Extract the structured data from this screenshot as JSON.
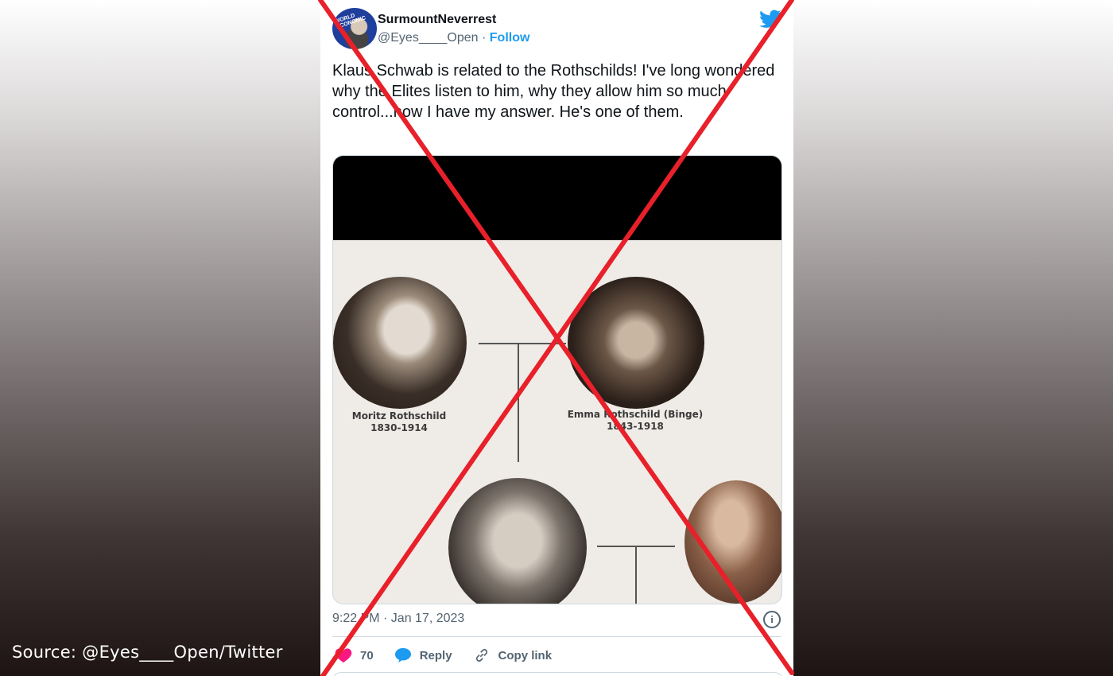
{
  "source_caption": "Source: @Eyes____Open/Twitter",
  "tweet": {
    "display_name": "SurmountNeverrest",
    "handle": "@Eyes____Open",
    "separator": " · ",
    "follow_label": "Follow",
    "avatar_text": "WORLD ECONOMIC",
    "text": "Klaus Schwab is related to the Rothschilds! I've long wondered why the Elites listen to him, why they allow him so much control...now I have my answer. He's one of them.",
    "timestamp": "9:22 PM · Jan 17, 2023",
    "media": {
      "captions": [
        {
          "name": "Moritz Rothschild",
          "years": "1830-1914"
        },
        {
          "name": "Emma Rothschild (Binge)",
          "years": "1843-1918"
        }
      ]
    },
    "actions": {
      "like_count": "70",
      "reply_label": "Reply",
      "copy_label": "Copy link"
    }
  },
  "colors": {
    "accent": "#1d9bf0",
    "like": "#f91880",
    "cross": "#e8202a"
  },
  "icons": [
    "twitter-bird-icon",
    "info-icon",
    "heart-icon",
    "reply-bubble-icon",
    "link-icon"
  ]
}
